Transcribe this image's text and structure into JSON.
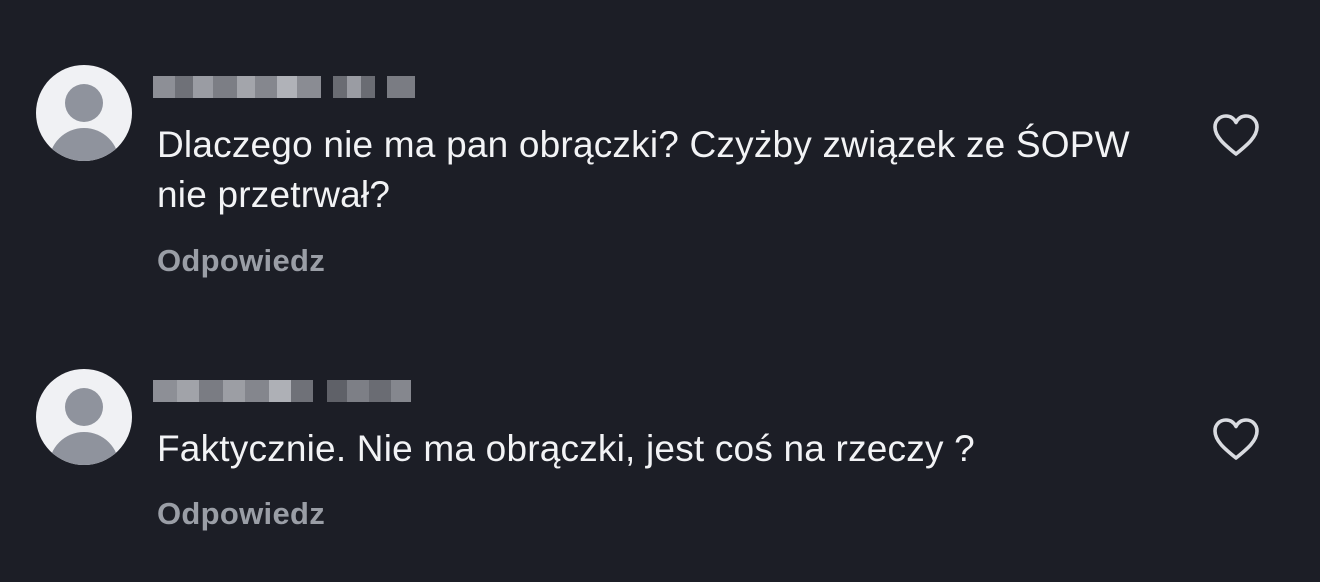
{
  "comments": [
    {
      "text": "Dlaczego nie ma pan obrączki? Czyżby związek ze ŚOPW nie przetrwał?",
      "reply_label": "Odpowiedz",
      "like_icon": "heart-outline-icon"
    },
    {
      "text": "Faktycznie. Nie ma obrączki, jest coś na rzeczy ?",
      "reply_label": "Odpowiedz",
      "like_icon": "heart-outline-icon"
    }
  ],
  "colors": {
    "background": "#1c1e26",
    "text": "#f2f3f5",
    "reply": "#9a9ea6",
    "avatar_bg": "#f0f1f4",
    "avatar_fg": "#8f939d"
  }
}
